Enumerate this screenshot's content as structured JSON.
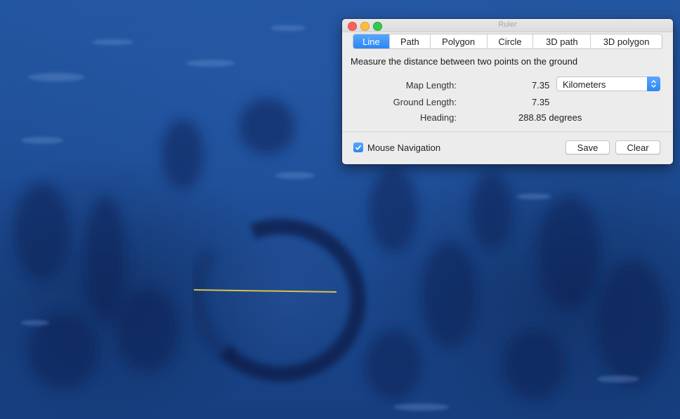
{
  "window": {
    "title": "Ruler"
  },
  "tabs": [
    {
      "label": "Line",
      "active": true
    },
    {
      "label": "Path",
      "active": false
    },
    {
      "label": "Polygon",
      "active": false
    },
    {
      "label": "Circle",
      "active": false
    },
    {
      "label": "3D path",
      "active": false
    },
    {
      "label": "3D polygon",
      "active": false
    }
  ],
  "description": "Measure the distance between two points on the ground",
  "measurements": {
    "map_length_label": "Map Length:",
    "map_length_value": "7.35",
    "ground_length_label": "Ground Length:",
    "ground_length_value": "7.35",
    "heading_label": "Heading:",
    "heading_value": "288.85 degrees"
  },
  "units_select": {
    "selected": "Kilometers"
  },
  "footer": {
    "mouse_navigation_label": "Mouse Navigation",
    "mouse_navigation_checked": true,
    "save_label": "Save",
    "clear_label": "Clear"
  },
  "colors": {
    "accent": "#2b86f4",
    "measure_line": "#d8c24a",
    "ocean": "#1d4c93"
  }
}
